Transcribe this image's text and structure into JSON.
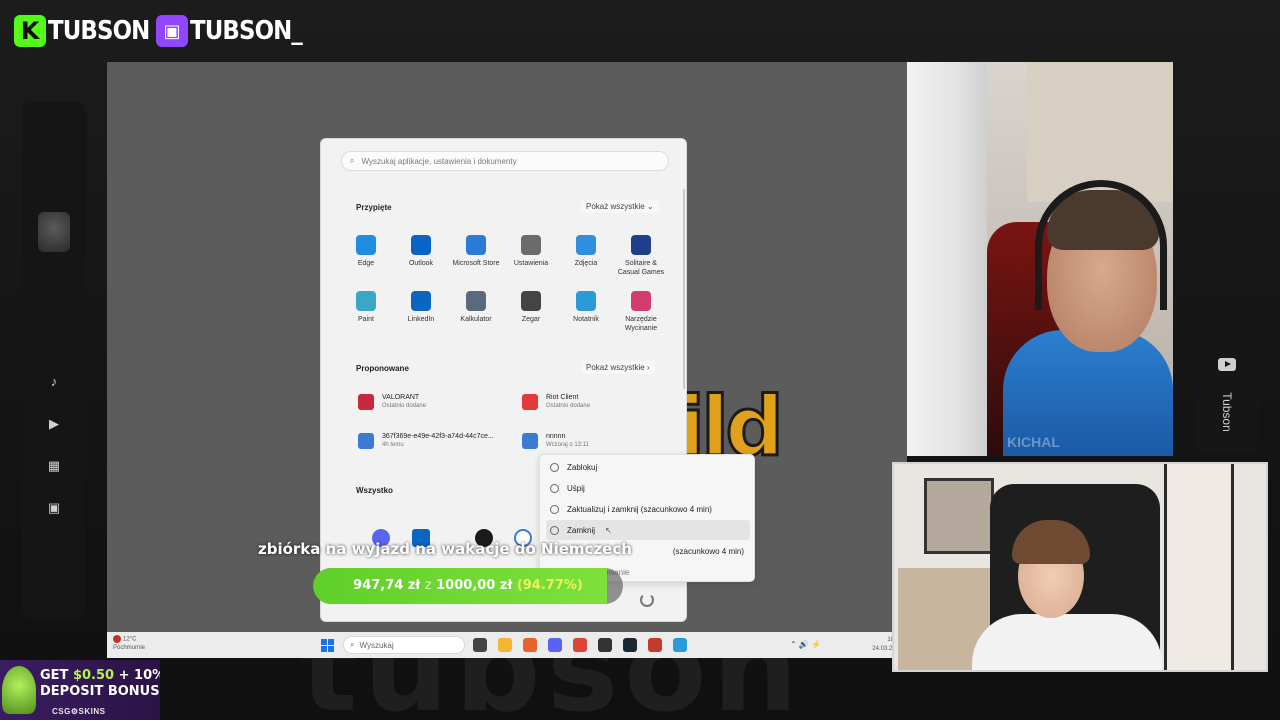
{
  "branding": {
    "kick_logo": "K",
    "kick_name": "TUBSON",
    "twitch_logo": "▣",
    "twitch_name": "TUBSON_",
    "colors": {
      "kick": "#53fc18",
      "twitch": "#9146ff"
    }
  },
  "background_watermark": "tubson",
  "right_tab": {
    "label": "Tubson",
    "icon": "youtube-icon"
  },
  "left_rail": {
    "icons": [
      "music-note-icon",
      "video-icon",
      "film-icon",
      "image-icon"
    ]
  },
  "start_menu": {
    "search_placeholder": "Wyszukaj aplikacje, ustawienia i dokumenty",
    "pinned": {
      "title": "Przypięte",
      "more": "Pokaż wszystkie",
      "apps": [
        {
          "label": "Edge",
          "color": "#1f8de0"
        },
        {
          "label": "Outlook",
          "color": "#0a64c8"
        },
        {
          "label": "Microsoft Store",
          "color": "#2a7bd6"
        },
        {
          "label": "Ustawienia",
          "color": "#6b6b6b"
        },
        {
          "label": "Zdjęcia",
          "color": "#2f8fdc"
        },
        {
          "label": "Solitaire & Casual Games",
          "color": "#1e3f8a"
        },
        {
          "label": "Paint",
          "color": "#3aa6c8"
        },
        {
          "label": "LinkedIn",
          "color": "#0a66c2"
        },
        {
          "label": "Kalkulator",
          "color": "#5a6a7a"
        },
        {
          "label": "Zegar",
          "color": "#444444"
        },
        {
          "label": "Notatnik",
          "color": "#2d9ad8"
        },
        {
          "label": "Narzędzie Wycinanie",
          "color": "#d13c6c"
        }
      ]
    },
    "recommended": {
      "title": "Proponowane",
      "more": "Pokaż wszystkie",
      "items": [
        {
          "name": "VALORANT",
          "sub": "Ostatnio dodane",
          "color": "#c8283a"
        },
        {
          "name": "Riot Client",
          "sub": "Ostatnio dodane",
          "color": "#e03a3a"
        },
        {
          "name": "367f369e-e49e-42f3-a74d-44c7ce...",
          "sub": "4h temu",
          "color": "#3a7bd5"
        },
        {
          "name": "nnnnn",
          "sub": "Wczoraj o 13:11",
          "color": "#3a7bd5"
        }
      ]
    },
    "all_title": "Wszystko",
    "all_icons": [
      "discord-icon",
      "linkedin-icon",
      "steam-icon",
      "chrome-icon"
    ],
    "power_menu": {
      "items": [
        {
          "label": "Zablokuj"
        },
        {
          "label": "Uśpij"
        },
        {
          "label": "Zaktualizuj i zamknij (szacunkowo 4 min)"
        },
        {
          "label": "Zamknij",
          "hovered": true
        },
        {
          "label": "(szacunkowo 4 min)"
        },
        {
          "label": "owanie"
        }
      ]
    }
  },
  "taskbar": {
    "weather_temp": "12°C",
    "weather_desc": "Pochmurnie",
    "search_placeholder": "Wyszukaj",
    "time": "18:1",
    "date": "24.03.202",
    "app_colors": [
      "#444444",
      "#f2b632",
      "#e8632a",
      "#5865f2",
      "#db4437",
      "#333333",
      "#1b2838",
      "#c23b2e",
      "#2a9bd8"
    ]
  },
  "stream_overlay": {
    "goal_text": "zbiórka na wyjazd na wakacje do Niemczech",
    "raised": "947,74 zł",
    "separator": "z",
    "target": "1000,00 zł",
    "percent_label": "(94.77%)",
    "progress_fraction": 0.9477
  },
  "webcam_top": {
    "watermark": "KICHAL"
  },
  "promo": {
    "line1_prefix": "GET ",
    "line1_highlight": "$0.50",
    "line1_suffix": " + 10%",
    "line2": "DEPOSIT BONUS",
    "brand": "CSG⚙SKINS"
  }
}
